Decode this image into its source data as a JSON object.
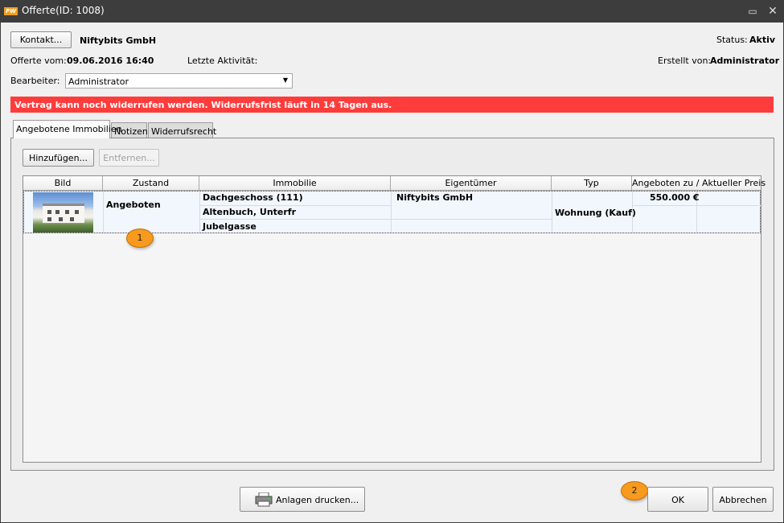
{
  "window": {
    "logo_text": "PW",
    "title": "Offerte(ID: 1008)",
    "maximize_glyph": "▭",
    "close_glyph": "✕"
  },
  "header": {
    "contact_button": "Kontakt...",
    "contact_name": "Niftybits GmbH",
    "status_label": "Status:",
    "status_value": "Aktiv",
    "offer_date_label": "Offerte vom:",
    "offer_date_value": "09.06.2016 16:40",
    "last_activity_label": "Letzte Aktivität:",
    "last_activity_value": "",
    "created_by_label": "Erstellt von:",
    "created_by_value": "Administrator",
    "editor_label": "Bearbeiter:",
    "editor_value": "Administrator"
  },
  "banner": {
    "text": "Vertrag kann noch widerrufen werden. Widerrufsfrist läuft in 14 Tagen aus.",
    "color": "#ff3c3c"
  },
  "tabs": [
    {
      "label": "Angebotene Immobilien",
      "active": true
    },
    {
      "label": "Notizen",
      "active": false
    },
    {
      "label": "Widerrufsrecht",
      "active": false
    }
  ],
  "toolbar": {
    "add_button": "Hinzufügen...",
    "remove_button": "Entfernen..."
  },
  "table": {
    "columns": [
      "Bild",
      "Zustand",
      "Immobilie",
      "Eigentümer",
      "Typ",
      "Angeboten zu / Aktueller Preis"
    ],
    "rows": [
      {
        "image": "house-thumbnail",
        "state": "Angeboten",
        "property_line1": "Dachgeschoss (111)",
        "property_line2": "Altenbuch,  Unterfr",
        "property_line3": "Jubelgasse",
        "owner": "Niftybits GmbH",
        "type": "Wohnung (Kauf)",
        "price": "550.000 €"
      }
    ]
  },
  "callouts": [
    {
      "label": "1",
      "color": "#f79a1e"
    },
    {
      "label": "2",
      "color": "#f79a1e"
    }
  ],
  "footer": {
    "print_button": "Anlagen drucken...",
    "ok_button": "OK",
    "cancel_button": "Abbrechen"
  }
}
